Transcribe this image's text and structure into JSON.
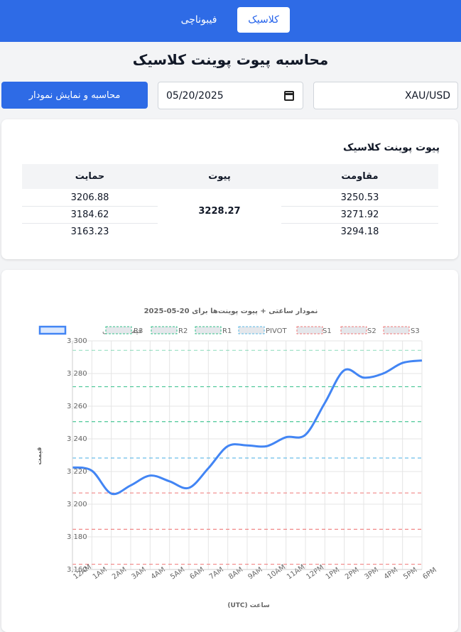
{
  "nav": {
    "tab_classic": "کلاسیک",
    "tab_fibonacci": "فیبوناچی"
  },
  "page": {
    "title": "محاسبه پیوت پوینت کلاسیک"
  },
  "form": {
    "symbol_value": "XAU/USD",
    "date_value": "05/20/2025",
    "calc_button": "محاسبه و نمایش نمودار"
  },
  "results": {
    "title": "پیوت پوینت کلاسیک",
    "headers": {
      "resistance": "مقاومت",
      "pivot": "پیوت",
      "support": "حمایت"
    },
    "resistance": [
      "3250.53",
      "3271.92",
      "3294.18"
    ],
    "pivot": "3228.27",
    "support": [
      "3206.88",
      "3184.62",
      "3163.23"
    ]
  },
  "colors": {
    "accent": "#2e6be6",
    "price_line": "#4285f4",
    "resistance": "#34c08a",
    "pivot": "#5bb8e6",
    "support": "#f07b7b"
  },
  "chart_data": {
    "type": "line",
    "title": "نمودار ساعتی + پیوت پوینت‌ها برای 20-05-2025",
    "xlabel": "ساعت (UTC)",
    "ylabel": "قیمت",
    "ylim": [
      3160,
      3300
    ],
    "yticks": [
      "3,160",
      "3,180",
      "3,200",
      "3,220",
      "3,240",
      "3,260",
      "3,280",
      "3,300"
    ],
    "categories": [
      "12AM",
      "1AM",
      "2AM",
      "3AM",
      "4AM",
      "5AM",
      "6AM",
      "7AM",
      "8AM",
      "9AM",
      "10AM",
      "11AM",
      "12PM",
      "1PM",
      "2PM",
      "3PM",
      "4PM",
      "5PM",
      "6PM"
    ],
    "series": [
      {
        "name": "قیمت ساعتی",
        "values": [
          3222.5,
          3220.5,
          3206.5,
          3211.5,
          3217.5,
          3214,
          3210,
          3222,
          3235.5,
          3236,
          3235.5,
          3241,
          3242.5,
          3262,
          3282,
          3277.5,
          3280,
          3286.5,
          3288
        ]
      }
    ],
    "levels": [
      {
        "name": "R3",
        "value": 3294.18,
        "kind": "resistance"
      },
      {
        "name": "R2",
        "value": 3271.92,
        "kind": "resistance"
      },
      {
        "name": "R1",
        "value": 3250.53,
        "kind": "resistance"
      },
      {
        "name": "PIVOT",
        "value": 3228.27,
        "kind": "pivot"
      },
      {
        "name": "S1",
        "value": 3206.88,
        "kind": "support"
      },
      {
        "name": "S2",
        "value": 3184.62,
        "kind": "support"
      },
      {
        "name": "S3",
        "value": 3163.23,
        "kind": "support"
      }
    ],
    "legend_position": "top",
    "grid": true
  }
}
